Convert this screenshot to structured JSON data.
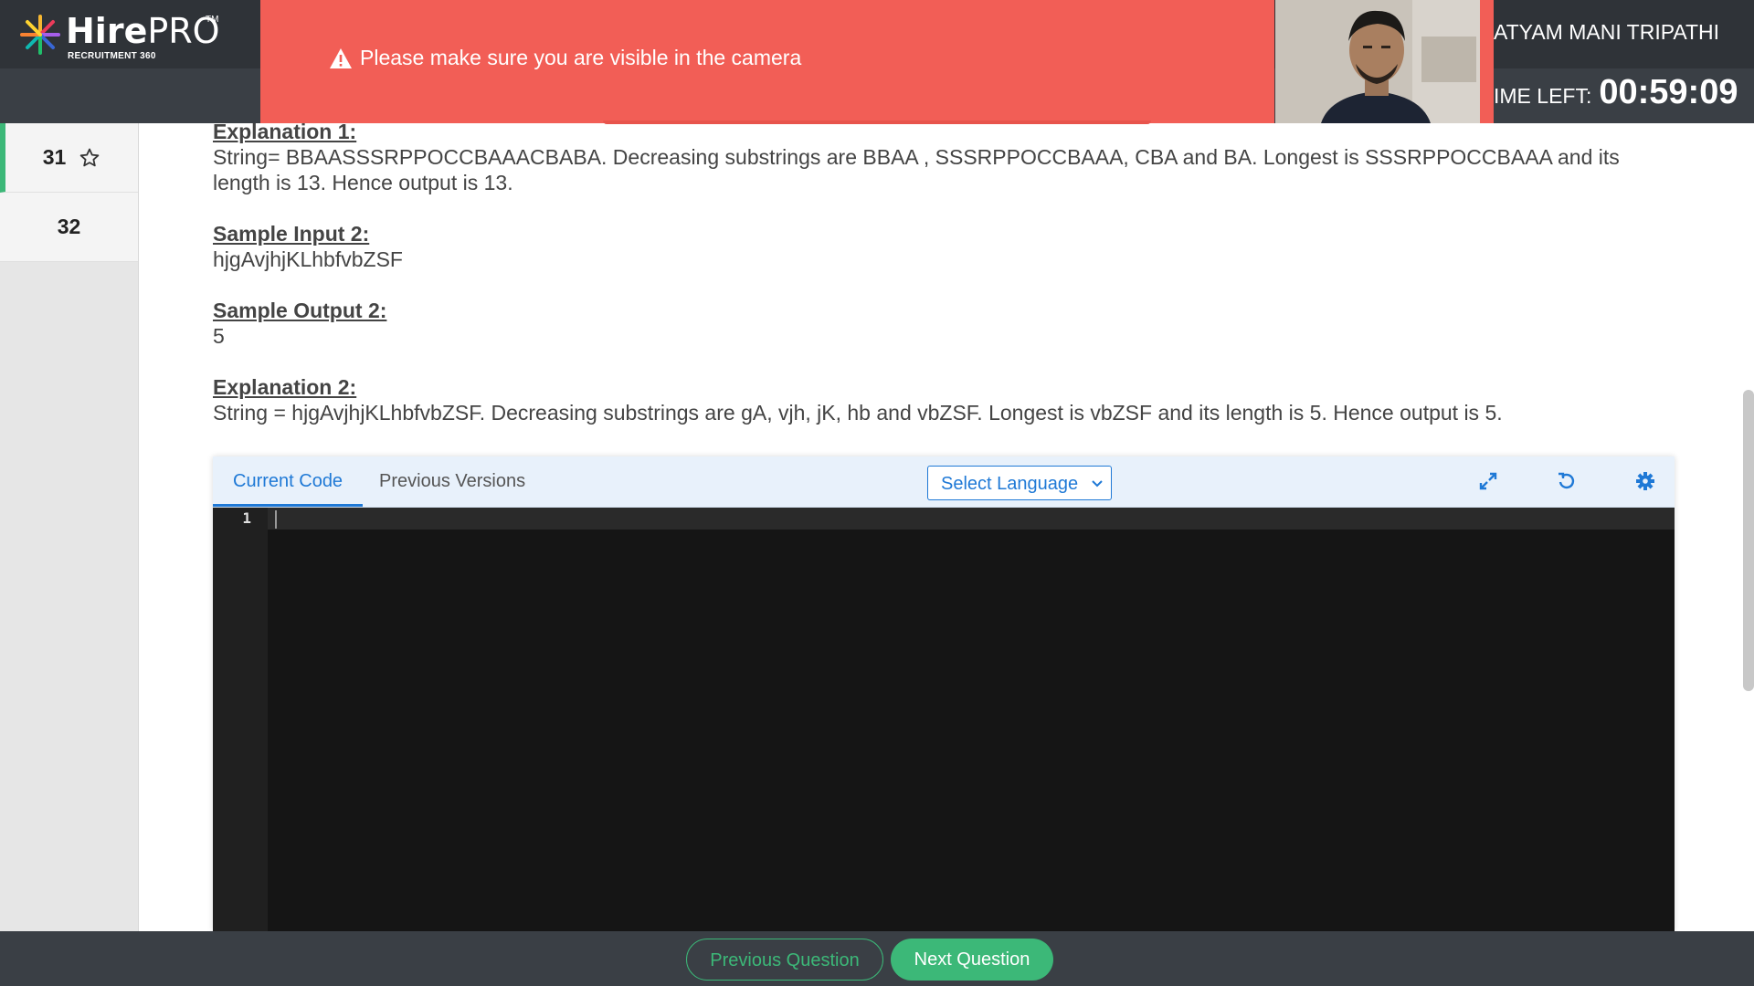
{
  "header": {
    "logo": {
      "brand_bold": "Hire",
      "brand_light": "PRO",
      "tm": "TM",
      "tagline": "RECRUITMENT 360"
    },
    "alert": {
      "icon": "warning-icon",
      "text": "Please make sure you are visible in the camera"
    },
    "candidate_name": "ATYAM MANI TRIPATHI",
    "timer": {
      "label": "IME LEFT:",
      "value": "00:59:09"
    }
  },
  "sidebar": {
    "items": [
      {
        "label": "31",
        "active": true,
        "icon": "star-outline-icon"
      },
      {
        "label": "32",
        "active": false
      }
    ]
  },
  "question": {
    "explanation1": {
      "heading": "Explanation 1:",
      "line1": "String= BBAASSSRPPOCCBAAACBABA. Decreasing substrings are BBAA , SSSRPPOCCBAAA, CBA and BA. Longest is  SSSRPPOCCBAAA and its",
      "line2": "length is 13. Hence output is 13."
    },
    "sample_input2": {
      "heading": "Sample Input 2:",
      "value": "hjgAvjhjKLhbfvbZSF"
    },
    "sample_output2": {
      "heading": "Sample Output 2:",
      "value": "5"
    },
    "explanation2": {
      "heading": "Explanation 2:",
      "text": "String = hjgAvjhjKLhbfvbZSF.  Decreasing substrings are gA, vjh, jK, hb and vbZSF. Longest is vbZSF and its length is 5. Hence output is 5."
    }
  },
  "editor": {
    "tabs": [
      {
        "label": "Current Code"
      },
      {
        "label": "Previous Versions"
      }
    ],
    "language_select": {
      "label": "Select Language"
    },
    "tools": [
      "expand-icon",
      "reset-icon",
      "settings-icon"
    ],
    "line_number": "1",
    "accent": "#1f79d6"
  },
  "footer": {
    "prev_label": "Previous Question",
    "next_label": "Next Question",
    "accent": "#3cb878"
  },
  "colors": {
    "alert": "#f25e56",
    "header": "#2f3338"
  }
}
